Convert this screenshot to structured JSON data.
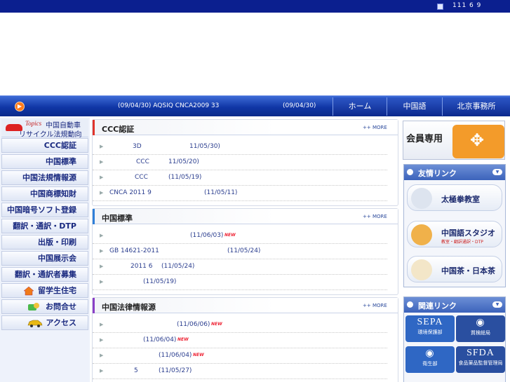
{
  "top": {
    "date": "111 6 9"
  },
  "news": {
    "item1": "(09/04/30) AQSIQ CNCA2009 33",
    "item2": "(09/04/30)"
  },
  "nav": {
    "tabs": [
      "ホーム",
      "中国語",
      "北京事務所"
    ]
  },
  "sidebar": {
    "topics_label": "Topics",
    "topics_line1": "中国自動車",
    "topics_line2": "リサイクル法規動向",
    "items": [
      "CCC認証",
      "中国標準",
      "中国法規情報源",
      "中国商標知財",
      "中国暗号ソフト登録",
      "翻訳・通訳・DTP",
      "出版・印刷",
      "中国展示会",
      "翻訳・通訳者募集",
      "留学生住宅",
      "お問合せ",
      "アクセス"
    ]
  },
  "sections": [
    {
      "title": "CCC認証",
      "more": "++ MORE",
      "items": [
        {
          "text": "3D",
          "date": "11/05/30)"
        },
        {
          "text": "CCC",
          "date": "11/05/20)"
        },
        {
          "text": "CCC",
          "date": "(11/05/19)"
        },
        {
          "text": "CNCA 2011 9",
          "date": "(11/05/11)"
        }
      ]
    },
    {
      "title": "中国標準",
      "more": "++ MORE",
      "items": [
        {
          "text": "",
          "date": "(11/06/03)",
          "new": "NEW"
        },
        {
          "text": "GB 14621-2011",
          "date": "(11/05/24)"
        },
        {
          "text": "2011 6",
          "date": "(11/05/24)"
        },
        {
          "text": "",
          "date": "(11/05/19)"
        }
      ]
    },
    {
      "title": "中国法律情報源",
      "more": "++ MORE",
      "items": [
        {
          "text": "",
          "date": "(11/06/06)",
          "new": "NEW"
        },
        {
          "text": "",
          "date": "(11/06/04)",
          "new": "NEW"
        },
        {
          "text": "",
          "date": "(11/06/04)",
          "new": "NEW"
        },
        {
          "text": "5",
          "date": "(11/05/27)"
        }
      ]
    }
  ],
  "member": {
    "label": "会員専用"
  },
  "friends": {
    "title": "友情リンク",
    "links": [
      {
        "label": "太極拳教室"
      },
      {
        "label": "中国語スタジオ",
        "sub": "教室・翻訳通訳・DTP"
      },
      {
        "label": "中国茶・日本茶"
      }
    ]
  },
  "related": {
    "title": "関連リンク",
    "logos": [
      {
        "big": "SEPA",
        "small": "環境保護部"
      },
      {
        "big": "",
        "small": "質検総局"
      },
      {
        "big": "",
        "small": "衛生部"
      },
      {
        "big": "SFDA",
        "small": "食品薬品監督管理局"
      }
    ]
  },
  "colors": {
    "header": "#0b1f8f",
    "nav": "#1036a6",
    "accent_red": "#e23333",
    "link_blue": "#2b3e8f"
  }
}
